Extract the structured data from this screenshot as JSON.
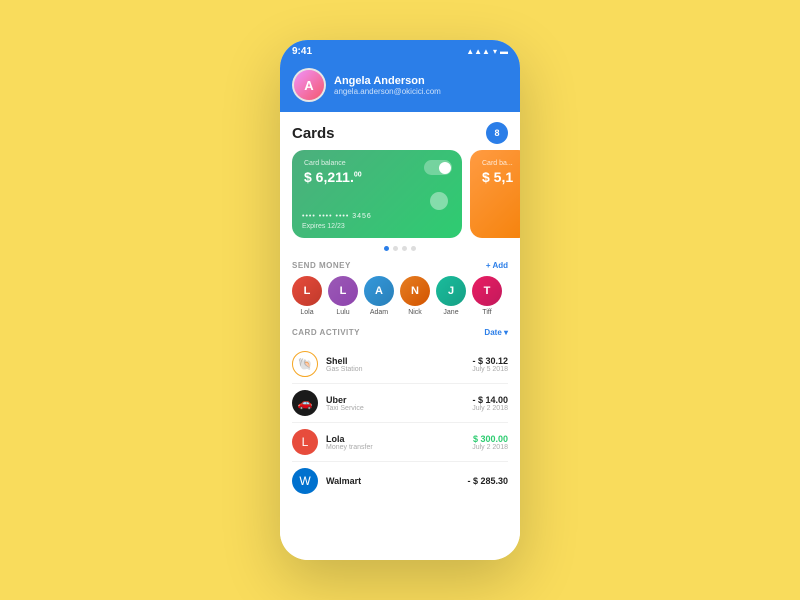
{
  "statusBar": {
    "time": "9:41",
    "icons": [
      "signal",
      "wifi",
      "battery"
    ]
  },
  "header": {
    "userName": "Angela Anderson",
    "userEmail": "angela.anderson@okicici.com",
    "avatarInitial": "A"
  },
  "cardsSection": {
    "title": "Cards",
    "badgeCount": "8",
    "cards": [
      {
        "id": 1,
        "color": "green",
        "balanceLabel": "Card balance",
        "balance": "$ 6,211.",
        "balanceCents": "00",
        "cardNumber": "••••  ••••  ••••  3456",
        "expiry": "Expires 12/23"
      },
      {
        "id": 2,
        "color": "orange",
        "balanceLabel": "Card ba...",
        "balance": "$ 5,1"
      }
    ],
    "dots": [
      true,
      false,
      false,
      false
    ]
  },
  "sendMoney": {
    "label": "SEND MONEY",
    "addLabel": "+ Add",
    "contacts": [
      {
        "name": "Lola",
        "initial": "L",
        "colorClass": "ca1"
      },
      {
        "name": "Lulu",
        "initial": "L",
        "colorClass": "ca2"
      },
      {
        "name": "Adam",
        "initial": "A",
        "colorClass": "ca3"
      },
      {
        "name": "Nick",
        "initial": "N",
        "colorClass": "ca4"
      },
      {
        "name": "Jane",
        "initial": "J",
        "colorClass": "ca5"
      },
      {
        "name": "Tiff",
        "initial": "T",
        "colorClass": "ca6"
      }
    ]
  },
  "cardActivity": {
    "label": "CARD ACTIVITY",
    "dateFilter": "Date ▾",
    "transactions": [
      {
        "name": "Shell",
        "sub": "Gas Station",
        "amount": "- $ 30.12",
        "date": "July 5 2018",
        "type": "negative",
        "icon": "🐚",
        "iconBg": "#fff",
        "iconBorder": "#f5a623"
      },
      {
        "name": "Uber",
        "sub": "Taxi Service",
        "amount": "- $ 14.00",
        "date": "July 2 2018",
        "type": "negative",
        "icon": "🚗",
        "iconBg": "#1a1a1a",
        "iconBorder": "#1a1a1a"
      },
      {
        "name": "Lola",
        "sub": "Money transfer",
        "amount": "$ 300.00",
        "date": "July 2 2018",
        "type": "positive",
        "icon": "L",
        "iconBg": "#e74c3c",
        "iconBorder": "#e74c3c"
      },
      {
        "name": "Walmart",
        "sub": "",
        "amount": "- $ 285.30",
        "date": "",
        "type": "negative",
        "icon": "W",
        "iconBg": "#0071CE",
        "iconBorder": "#0071CE"
      }
    ]
  }
}
